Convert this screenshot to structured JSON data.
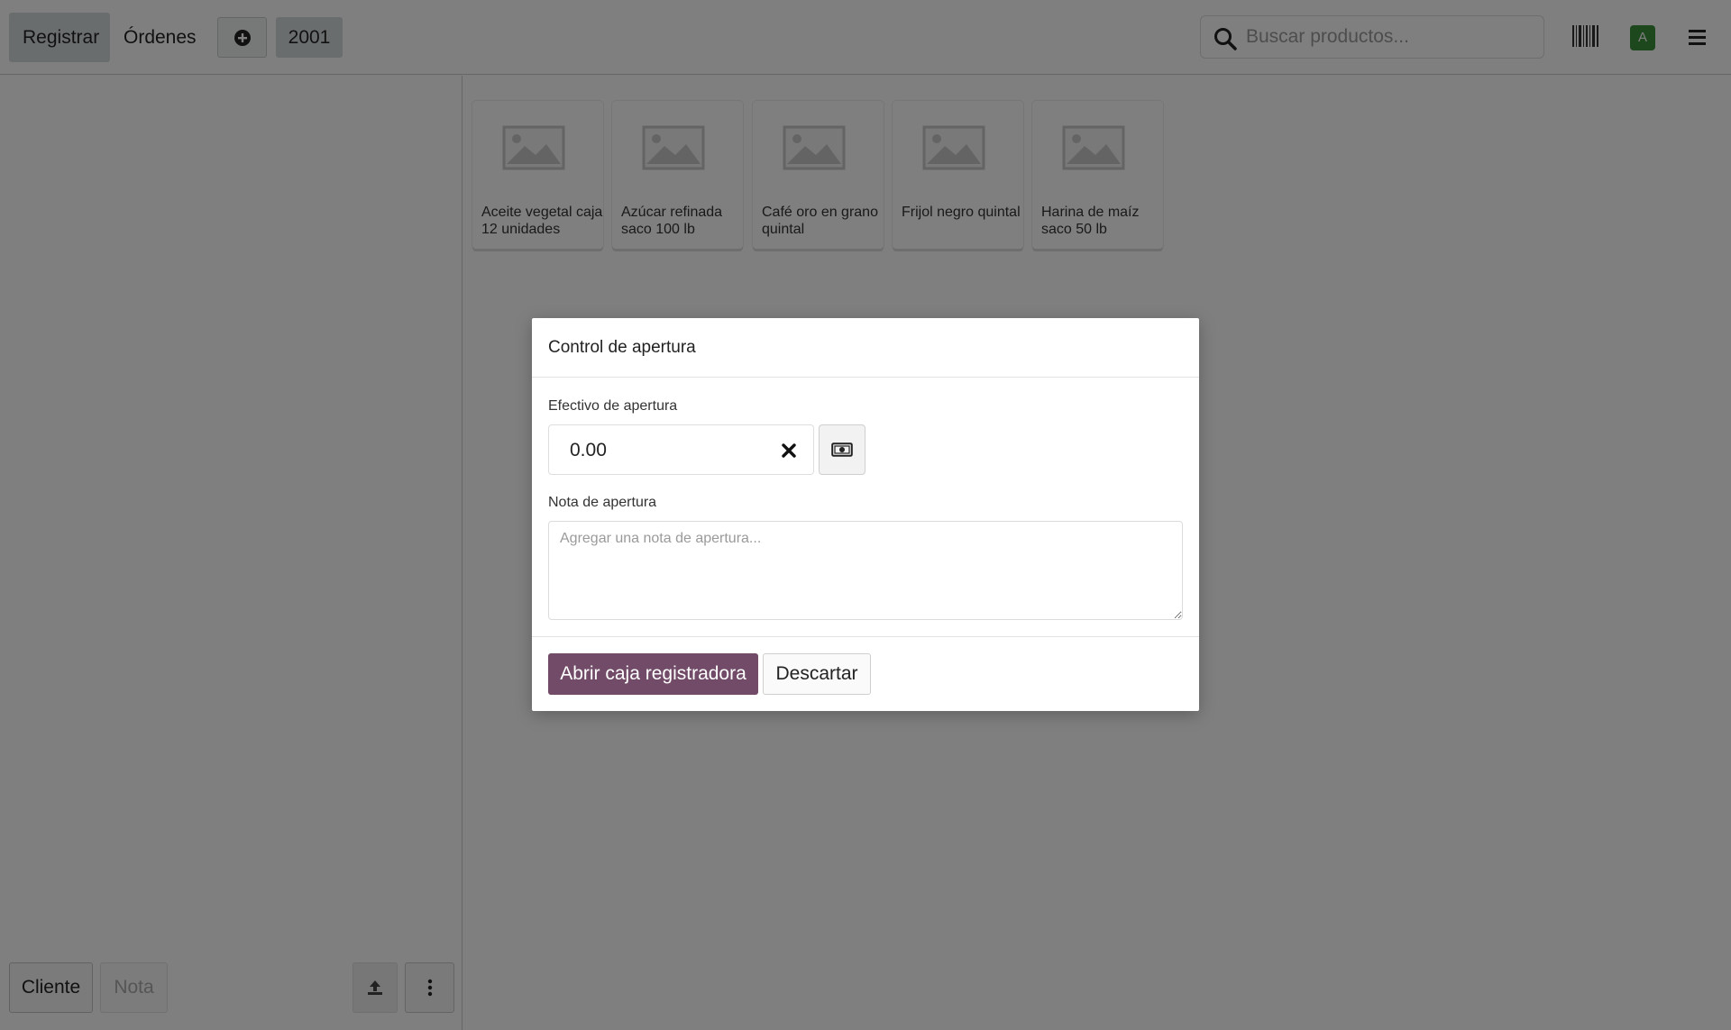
{
  "topbar": {
    "tabs": [
      {
        "label": "Registrar",
        "active": true
      },
      {
        "label": "Órdenes",
        "active": false
      }
    ],
    "order_number": "2001",
    "search": {
      "placeholder": "Buscar productos..."
    },
    "user_initial": "A",
    "avatar_color": "#3a8f3a"
  },
  "left_pane": {
    "customer_label": "Cliente",
    "note_label": "Nota"
  },
  "products": [
    {
      "name": "Aceite vegetal caja 12 unidades"
    },
    {
      "name": "Azúcar refinada saco 100 lb"
    },
    {
      "name": "Café oro en grano quintal"
    },
    {
      "name": "Frijol negro quintal"
    },
    {
      "name": "Harina de maíz saco 50 lb"
    }
  ],
  "modal": {
    "title": "Control de apertura",
    "cash_label": "Efectivo de apertura",
    "cash_value": "0.00",
    "note_label": "Nota de apertura",
    "note_placeholder": "Agregar una nota de apertura...",
    "primary_label": "Abrir caja registradora",
    "secondary_label": "Descartar",
    "accent_color": "#714b67"
  }
}
